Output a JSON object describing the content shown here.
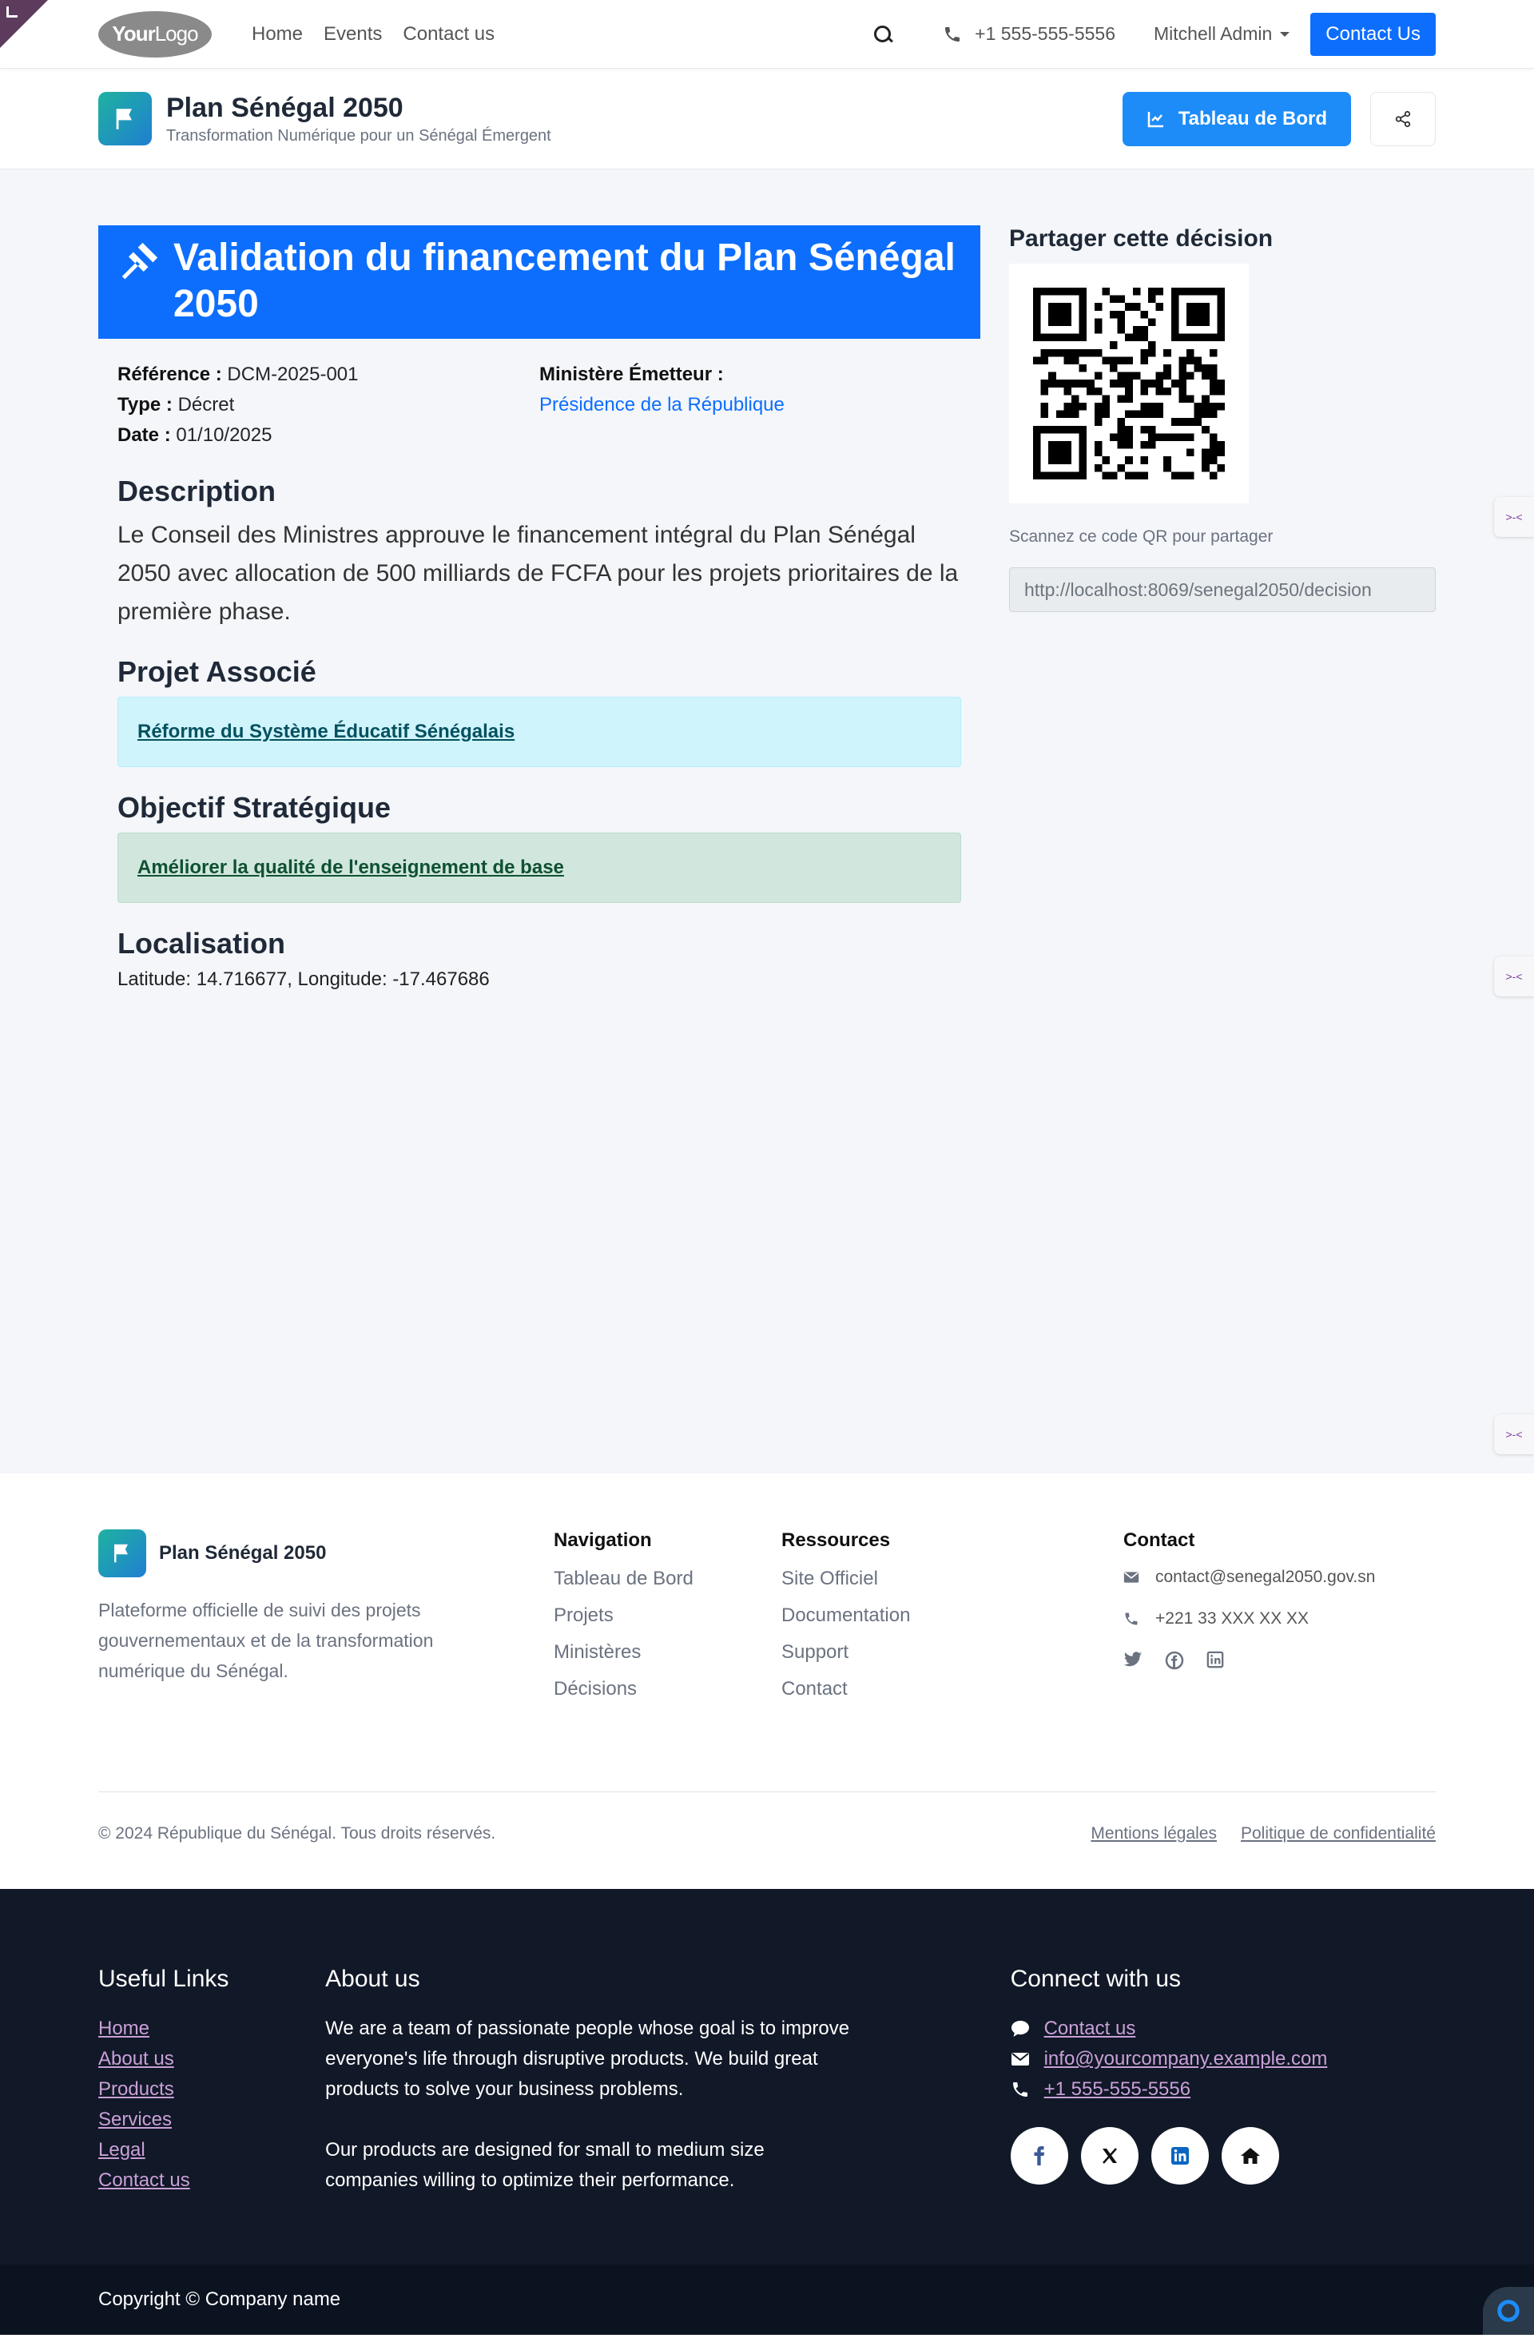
{
  "topnav": {
    "logo_bold": "Your",
    "logo_thin": "Logo",
    "links": [
      "Home",
      "Events",
      "Contact us"
    ],
    "phone": "+1 555-555-5556",
    "user": "Mitchell Admin",
    "cta": "Contact Us"
  },
  "subheader": {
    "title": "Plan Sénégal 2050",
    "subtitle": "Transformation Numérique pour un Sénégal Émergent",
    "dashboard_button": "Tableau de Bord"
  },
  "decision": {
    "title": "Validation du financement du Plan Sénégal 2050",
    "reference_label": "Référence :",
    "reference": "DCM-2025-001",
    "type_label": "Type :",
    "type": "Décret",
    "date_label": "Date :",
    "date": "01/10/2025",
    "ministry_label": "Ministère Émetteur :",
    "ministry": "Présidence de la République",
    "description_title": "Description",
    "description": "Le Conseil des Ministres approuve le financement intégral du Plan Sénégal 2050 avec allocation de 500 milliards de FCFA pour les projets prioritaires de la première phase.",
    "project_title": "Projet Associé",
    "project": "Réforme du Système Éducatif Sénégalais",
    "objective_title": "Objectif Stratégique",
    "objective": "Améliorer la qualité de l'enseignement de base",
    "location_title": "Localisation",
    "location": "Latitude: 14.716677, Longitude: -17.467686"
  },
  "share": {
    "title": "Partager cette décision",
    "caption": "Scannez ce code QR pour partager",
    "url": "http://localhost:8069/senegal2050/decision"
  },
  "site_footer": {
    "brand": "Plan Sénégal 2050",
    "about": "Plateforme officielle de suivi des projets gouvernementaux et de la transformation numérique du Sénégal.",
    "nav_title": "Navigation",
    "nav_links": [
      "Tableau de Bord",
      "Projets",
      "Ministères",
      "Décisions"
    ],
    "res_title": "Ressources",
    "res_links": [
      "Site Officiel",
      "Documentation",
      "Support",
      "Contact"
    ],
    "contact_title": "Contact",
    "email": "contact@senegal2050.gov.sn",
    "phone": "+221 33 XXX XX XX",
    "copyright": "© 2024 République du Sénégal. Tous droits réservés.",
    "legal": "Mentions légales",
    "privacy": "Politique de confidentialité"
  },
  "dark_footer": {
    "links_title": "Useful Links",
    "links": [
      "Home",
      "About us",
      "Products",
      "Services",
      "Legal",
      "Contact us"
    ],
    "about_title": "About us",
    "about_p1": "We are a team of passionate people whose goal is to improve everyone's life through disruptive products. We build great products to solve your business problems.",
    "about_p2": "Our products are designed for small to medium size companies willing to optimize their performance.",
    "connect_title": "Connect with us",
    "contact_us": "Contact us",
    "email": "info@yourcompany.example.com",
    "phone": "+1 555-555-5556",
    "copyright": "Copyright © Company name"
  },
  "colors": {
    "primary": "#0d6efd",
    "dark_footer": "#111827",
    "link_purple": "#c9a0d8"
  }
}
